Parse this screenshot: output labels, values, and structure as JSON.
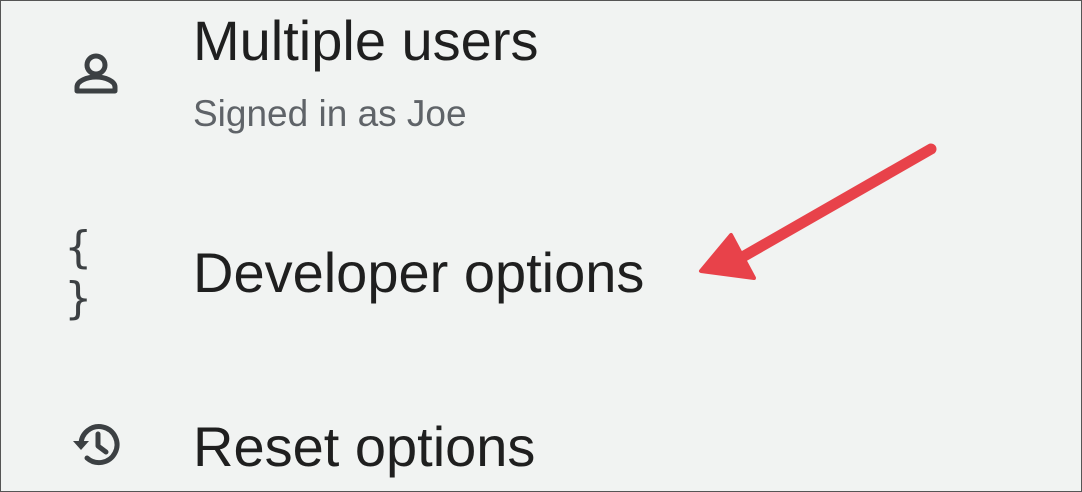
{
  "settings_list": {
    "items": [
      {
        "icon": "person-icon",
        "title": "Multiple users",
        "subtitle": "Signed in as Joe"
      },
      {
        "icon": "braces-icon",
        "icon_glyph": "{ }",
        "title": "Developer options"
      },
      {
        "icon": "history-icon",
        "title": "Reset options"
      }
    ]
  },
  "annotation": {
    "arrow_color": "#e8424a"
  }
}
